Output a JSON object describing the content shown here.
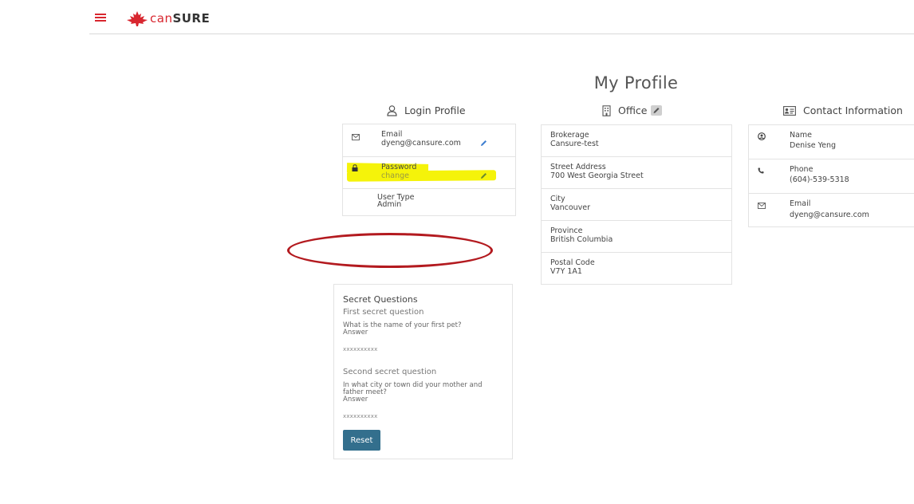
{
  "header": {
    "logo_prefix": "can",
    "logo_suffix": "SURE"
  },
  "page_title": "My Profile",
  "login_profile": {
    "heading": "Login Profile",
    "email_label": "Email",
    "email_value": "dyeng@cansure.com",
    "password_label": "Password",
    "password_action": "change",
    "user_type_label": "User Type",
    "user_type_value": "Admin"
  },
  "office": {
    "heading": "Office",
    "brokerage_label": "Brokerage",
    "brokerage_value": "Cansure-test",
    "street_label": "Street Address",
    "street_value": "700 West Georgia Street",
    "city_label": "City",
    "city_value": "Vancouver",
    "province_label": "Province",
    "province_value": "British Columbia",
    "postal_label": "Postal Code",
    "postal_value": "V7Y 1A1"
  },
  "contact": {
    "heading": "Contact Information",
    "name_label": "Name",
    "name_value": "Denise Yeng",
    "phone_label": "Phone",
    "phone_value": "(604)-539-5318",
    "email_label": "Email",
    "email_value": "dyeng@cansure.com"
  },
  "secret_questions": {
    "title": "Secret Questions",
    "first_heading": "First secret question",
    "first_question": "What is the name of your first pet?",
    "first_answer_label": "Answer",
    "first_answer_mask": "xxxxxxxxxx",
    "second_heading": "Second secret question",
    "second_question_line1": "In what city or town did your mother and",
    "second_question_line2": "father meet?",
    "second_answer_label": "Answer",
    "second_answer_mask": "xxxxxxxxxx",
    "reset_label": "Reset"
  },
  "colors": {
    "brand_red": "#d8262f",
    "button_blue": "#336f8d",
    "highlight_yellow": "#f5f30a",
    "annotation_red": "#b31a1f"
  }
}
